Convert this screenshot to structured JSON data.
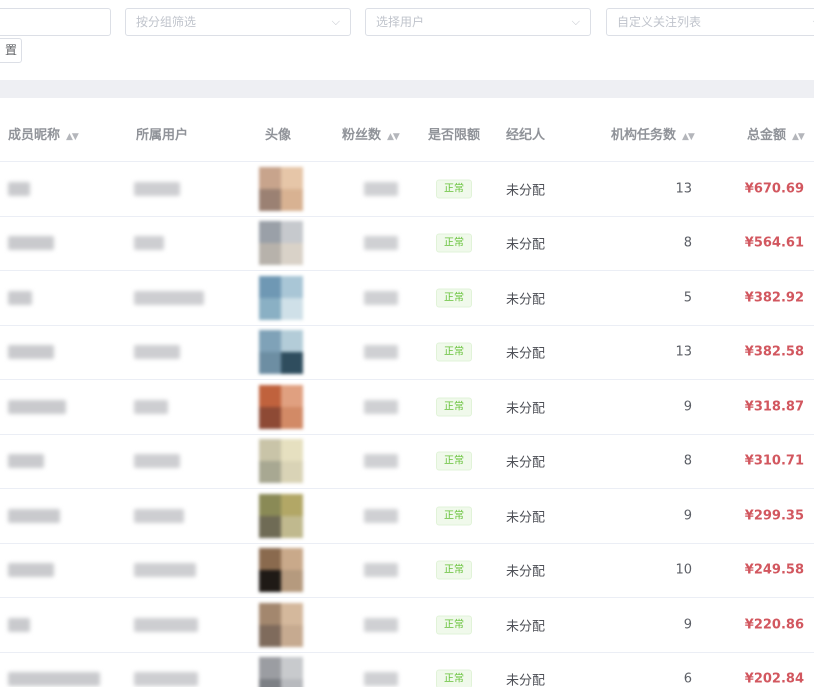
{
  "filters": {
    "first_placeholder": "",
    "group_placeholder": "按分组筛选",
    "user_placeholder": "选择用户",
    "columns_placeholder": "自定义关注列表",
    "reset_label": "置"
  },
  "table": {
    "headers": {
      "nickname": "成员昵称",
      "user": "所属用户",
      "avatar": "头像",
      "fans": "粉丝数",
      "limited": "是否限额",
      "agent": "经纪人",
      "tasks": "机构任务数",
      "total": "总金额"
    },
    "sort_glyph": "▲▼",
    "rows": [
      {
        "status": "正常",
        "agent": "未分配",
        "tasks": "13",
        "total": "¥670.69"
      },
      {
        "status": "正常",
        "agent": "未分配",
        "tasks": "8",
        "total": "¥564.61"
      },
      {
        "status": "正常",
        "agent": "未分配",
        "tasks": "5",
        "total": "¥382.92"
      },
      {
        "status": "正常",
        "agent": "未分配",
        "tasks": "13",
        "total": "¥382.58"
      },
      {
        "status": "正常",
        "agent": "未分配",
        "tasks": "9",
        "total": "¥318.87"
      },
      {
        "status": "正常",
        "agent": "未分配",
        "tasks": "8",
        "total": "¥310.71"
      },
      {
        "status": "正常",
        "agent": "未分配",
        "tasks": "9",
        "total": "¥299.35"
      },
      {
        "status": "正常",
        "agent": "未分配",
        "tasks": "10",
        "total": "¥249.58"
      },
      {
        "status": "正常",
        "agent": "未分配",
        "tasks": "9",
        "total": "¥220.86"
      },
      {
        "status": "正常",
        "agent": "未分配",
        "tasks": "6",
        "total": "¥202.84"
      }
    ]
  },
  "colors": {
    "total_amount": "#d2575f",
    "status_tag": "#67c23a",
    "divider": "#eeeff3"
  },
  "icons": {
    "select_arrow": "chevron-down-icon",
    "sort": "sort-icon"
  }
}
